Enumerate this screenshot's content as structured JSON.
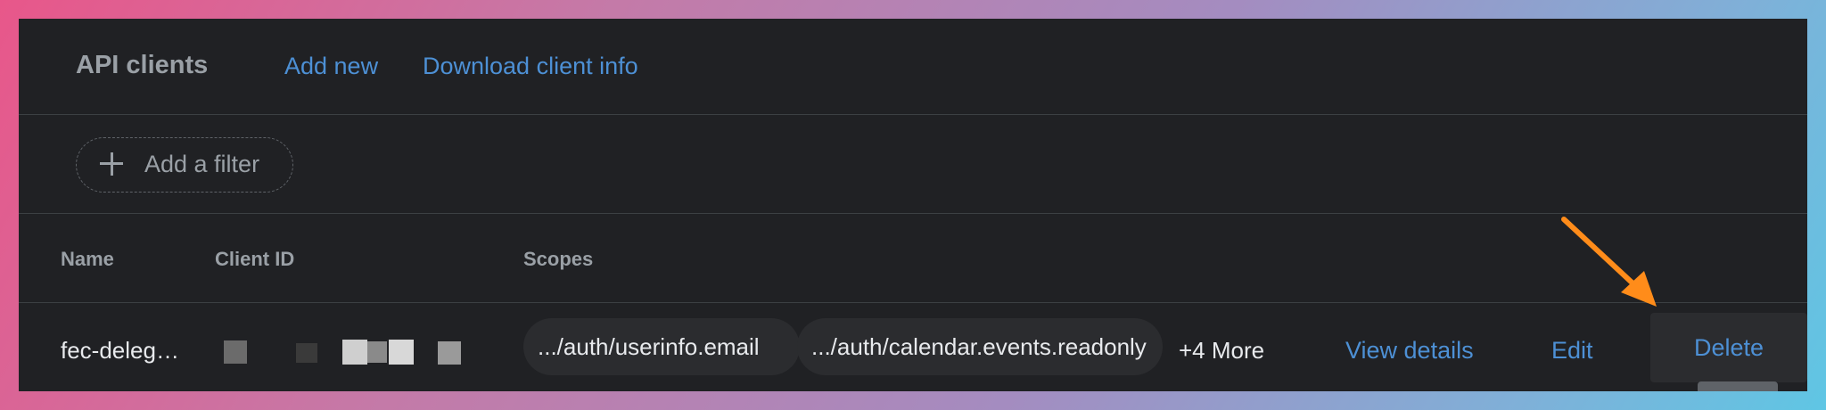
{
  "header": {
    "title": "API clients",
    "add_new": "Add new",
    "download": "Download client info"
  },
  "filter": {
    "label": "Add a filter"
  },
  "table": {
    "columns": [
      "Name",
      "Client ID",
      "Scopes"
    ],
    "rows": [
      {
        "name": "fec-deleg…",
        "client_id": "",
        "scopes": [
          ".../auth/userinfo.email",
          ".../auth/calendar.events.readonly"
        ],
        "more": "+4 More",
        "view_details": "View details",
        "edit": "Edit",
        "delete": "Delete"
      }
    ]
  },
  "annotation": {
    "arrow_color": "#ff8c1a",
    "arrow_target": "Delete"
  },
  "colors": {
    "panel_bg": "#202124",
    "link": "#4d90d5",
    "chip_bg": "#2b2c2f"
  }
}
